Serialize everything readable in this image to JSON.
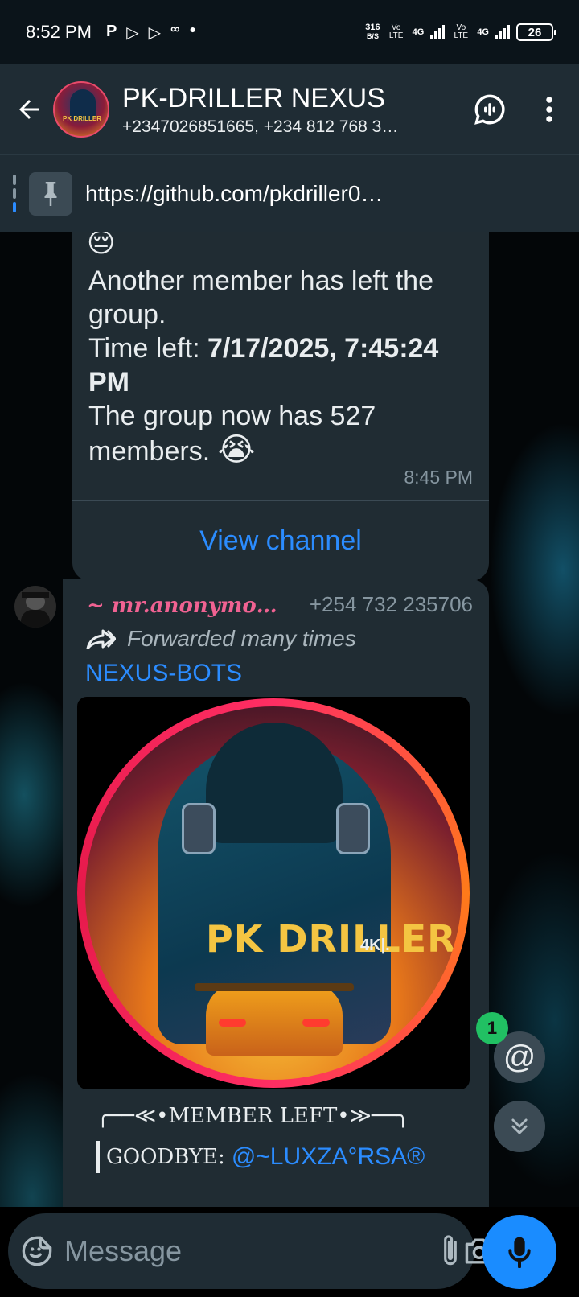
{
  "status_bar": {
    "time": "8:52 PM",
    "net_speed_value": "316",
    "net_speed_unit": "B/S",
    "sim1": "Vo LTE",
    "sim1_net": "4G",
    "sim2": "Vo LTE",
    "sim2_net": "4G",
    "battery": "26"
  },
  "header": {
    "group_name": "PK-DRILLER NEXUS",
    "members": "+2347026851665, +234 812 768 3…",
    "avatar_text": "PK DRILLER"
  },
  "pinned": {
    "url": "https://github.com/pkdriller0…"
  },
  "message1": {
    "emoji_top": "😔",
    "line1": "Another member has left the group.",
    "time_left_label": "Time left: ",
    "time_left_value": "7/17/2025, 7:45:24 PM",
    "count_text": "The group now has 527 members. ",
    "emoji_end": "😭",
    "time": "8:45 PM",
    "view_channel": "View channel"
  },
  "message2": {
    "sender_name": "~ mr.anonymo…",
    "sender_phone": "+254 732 235706",
    "forwarded": "Forwarded many times",
    "forward_title": "NEXUS-BOTS",
    "image_text": "PK DRILLER",
    "image_badge": "4K|.",
    "member_left": "╭──≪•MEMBER LEFT•≫──╮",
    "goodbye_label": "GOODBYE:",
    "goodbye_mention": "@~LUXZA°RSA®"
  },
  "mention_count": "1",
  "input": {
    "placeholder": "Message"
  },
  "colors": {
    "accent_blue": "#2b8cff",
    "sender_pink": "#f06292",
    "badge_green": "#21c063",
    "header_bg": "#1f2c34",
    "bubble_bg": "#202c33"
  }
}
